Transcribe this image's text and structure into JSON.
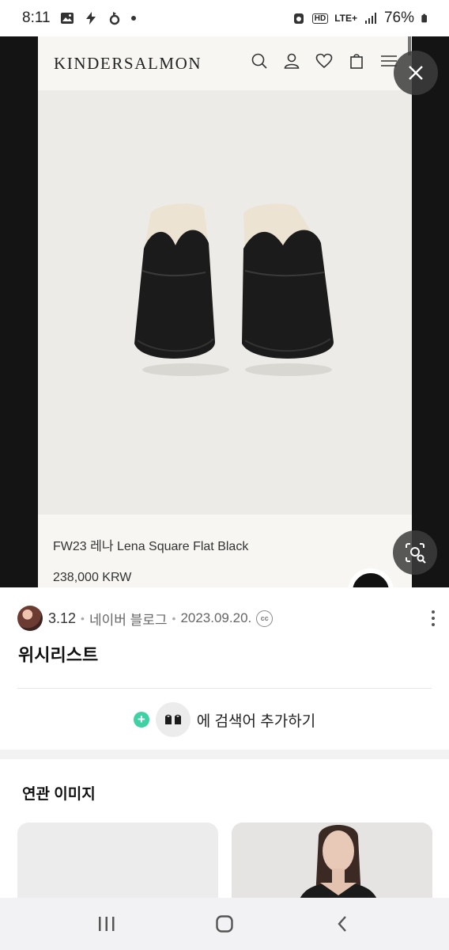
{
  "status_bar": {
    "time": "8:11",
    "left_icons": [
      "gallery-icon",
      "bolt-icon",
      "sync-icon"
    ],
    "right_icons": [
      "alarm-icon",
      "hd-icon",
      "lte-signal-icon",
      "signal-bars-icon",
      "battery-icon"
    ],
    "hd_label": "HD",
    "lte_label": "LTE+",
    "battery": "76%"
  },
  "viewer": {
    "brand": "KINDERSALMON",
    "header_icons": [
      "search-icon",
      "user-icon",
      "heart-icon",
      "bag-icon",
      "menu-icon"
    ],
    "product_name": "FW23 레나 Lena Square Flat Black",
    "product_price": "238,000 KRW",
    "close_icon": "close-icon",
    "lens_icon": "lens-search-icon"
  },
  "post": {
    "count": "3.12",
    "source": "네이버 블로그",
    "date": "2023.09.20.",
    "license_badge": "cc",
    "title": "위시리스트",
    "add_search_label": "에 검색어 추가하기"
  },
  "related": {
    "title": "연관 이미지"
  },
  "nav": {
    "icons": [
      "recent-apps-icon",
      "home-icon",
      "back-icon"
    ]
  },
  "colors": {
    "accent_green": "#3dd1a4",
    "viewer_bg": "#141414",
    "product_bg": "#ecebe7"
  }
}
